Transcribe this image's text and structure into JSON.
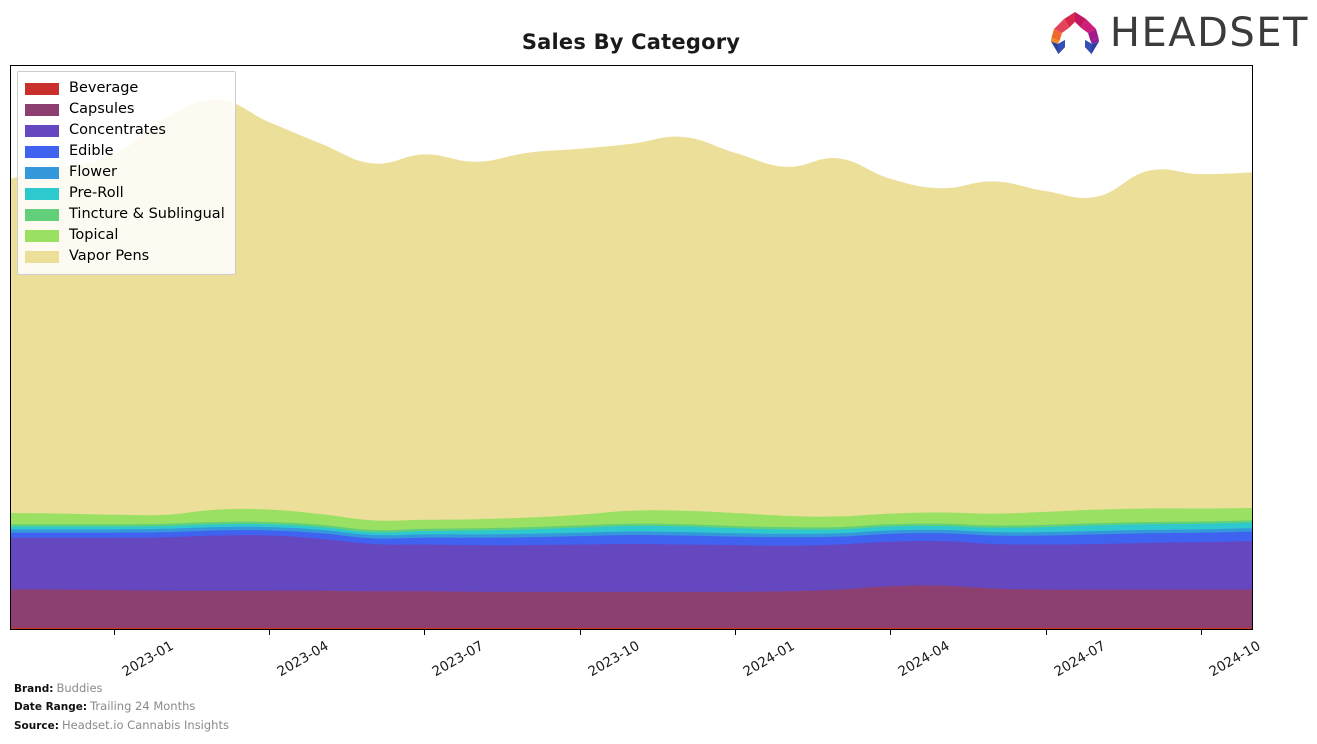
{
  "header": {
    "title": "Sales By Category",
    "logo_text": "HEADSET",
    "logo_icon": "headset-arch-icon"
  },
  "footer": {
    "rows": [
      {
        "key": "Brand:",
        "value": "Buddies"
      },
      {
        "key": "Date Range:",
        "value": "Trailing 24 Months"
      },
      {
        "key": "Source:",
        "value": "Headset.io Cannabis Insights"
      }
    ]
  },
  "legend": {
    "position": "upper-left",
    "items": [
      {
        "label": "Beverage",
        "color": "#c9302c"
      },
      {
        "label": "Capsules",
        "color": "#8e3f72"
      },
      {
        "label": "Concentrates",
        "color": "#6547c0"
      },
      {
        "label": "Edible",
        "color": "#3f63f0"
      },
      {
        "label": "Flower",
        "color": "#3498db"
      },
      {
        "label": "Pre-Roll",
        "color": "#2ec8cf"
      },
      {
        "label": "Tincture & Sublingual",
        "color": "#62d07a"
      },
      {
        "label": "Topical",
        "color": "#9ae063"
      },
      {
        "label": "Vapor Pens",
        "color": "#ecdf9a"
      }
    ]
  },
  "chart_data": {
    "type": "area",
    "stacked": true,
    "title": "Sales By Category",
    "xlabel": "",
    "ylabel": "",
    "grid": false,
    "legend_position": "upper-left",
    "x": [
      "2022-11",
      "2022-12",
      "2023-01",
      "2023-02",
      "2023-03",
      "2023-04",
      "2023-05",
      "2023-06",
      "2023-07",
      "2023-08",
      "2023-09",
      "2023-10",
      "2023-11",
      "2023-12",
      "2024-01",
      "2024-02",
      "2024-03",
      "2024-04",
      "2024-05",
      "2024-06",
      "2024-07",
      "2024-08",
      "2024-09",
      "2024-10",
      "2024-11"
    ],
    "xtick_labels": [
      "2023-01",
      "2023-04",
      "2023-07",
      "2023-10",
      "2024-01",
      "2024-04",
      "2024-07",
      "2024-10"
    ],
    "xtick_positions": [
      2,
      5,
      8,
      11,
      14,
      17,
      20,
      23
    ],
    "ylim": [
      0,
      100
    ],
    "yaxis_visible": false,
    "units": "percent of total sales",
    "series": [
      {
        "name": "Beverage",
        "color": "#c9302c",
        "values": [
          0.2,
          0.2,
          0.2,
          0.2,
          0.2,
          0.2,
          0.2,
          0.2,
          0.2,
          0.2,
          0.2,
          0.2,
          0.2,
          0.2,
          0.2,
          0.2,
          0.2,
          0.2,
          0.2,
          0.2,
          0.2,
          0.2,
          0.2,
          0.2,
          0.2
        ]
      },
      {
        "name": "Capsules",
        "color": "#8e3f72",
        "values": [
          6.8,
          6.8,
          6.7,
          6.6,
          6.6,
          6.6,
          6.6,
          6.5,
          6.5,
          6.4,
          6.4,
          6.4,
          6.4,
          6.4,
          6.4,
          6.5,
          6.8,
          7.4,
          7.5,
          7.0,
          6.8,
          6.8,
          6.8,
          6.8,
          6.8
        ]
      },
      {
        "name": "Concentrates",
        "color": "#6547c0",
        "values": [
          9.2,
          9.2,
          9.3,
          9.5,
          9.8,
          9.8,
          9.2,
          8.4,
          8.3,
          8.3,
          8.3,
          8.4,
          8.5,
          8.4,
          8.3,
          8.1,
          8.0,
          7.9,
          7.9,
          7.9,
          8.0,
          8.1,
          8.3,
          8.4,
          8.6
        ]
      },
      {
        "name": "Edible",
        "color": "#3f63f0",
        "values": [
          0.9,
          0.9,
          0.9,
          0.9,
          0.9,
          0.9,
          1.0,
          1.0,
          1.2,
          1.3,
          1.4,
          1.5,
          1.6,
          1.6,
          1.5,
          1.5,
          1.4,
          1.4,
          1.4,
          1.5,
          1.6,
          1.7,
          1.7,
          1.7,
          1.7
        ]
      },
      {
        "name": "Flower",
        "color": "#3498db",
        "values": [
          0.6,
          0.6,
          0.6,
          0.6,
          0.6,
          0.6,
          0.6,
          0.6,
          0.6,
          0.6,
          0.6,
          0.6,
          0.6,
          0.6,
          0.6,
          0.6,
          0.6,
          0.6,
          0.6,
          0.6,
          0.6,
          0.6,
          0.6,
          0.6,
          0.6
        ]
      },
      {
        "name": "Pre-Roll",
        "color": "#2ec8cf",
        "values": [
          0.5,
          0.5,
          0.5,
          0.5,
          0.5,
          0.5,
          0.5,
          0.5,
          0.6,
          0.7,
          0.8,
          0.9,
          1.0,
          1.0,
          0.9,
          0.8,
          0.7,
          0.7,
          0.7,
          0.8,
          0.9,
          1.0,
          1.0,
          1.0,
          1.0
        ]
      },
      {
        "name": "Tincture & Sublingual",
        "color": "#62d07a",
        "values": [
          0.4,
          0.4,
          0.4,
          0.4,
          0.4,
          0.4,
          0.4,
          0.4,
          0.4,
          0.4,
          0.4,
          0.4,
          0.4,
          0.4,
          0.4,
          0.4,
          0.4,
          0.4,
          0.4,
          0.4,
          0.4,
          0.4,
          0.4,
          0.4,
          0.4
        ]
      },
      {
        "name": "Topical",
        "color": "#9ae063",
        "values": [
          2.0,
          1.9,
          1.7,
          1.6,
          2.2,
          2.2,
          1.9,
          1.7,
          1.6,
          1.6,
          1.7,
          1.9,
          2.3,
          2.4,
          2.3,
          2.0,
          1.9,
          1.9,
          2.0,
          2.1,
          2.3,
          2.4,
          2.4,
          2.3,
          2.2
        ]
      },
      {
        "name": "Vapor Pens",
        "color": "#ecdf9a",
        "values": [
          59.4,
          61.6,
          64.0,
          70.5,
          72.8,
          68.8,
          65.8,
          63.4,
          64.9,
          63.5,
          64.8,
          65.0,
          65.2,
          66.4,
          64.0,
          62.0,
          63.6,
          59.5,
          57.6,
          59.0,
          57.0,
          55.6,
          60.0,
          59.4,
          59.6
        ]
      }
    ]
  }
}
